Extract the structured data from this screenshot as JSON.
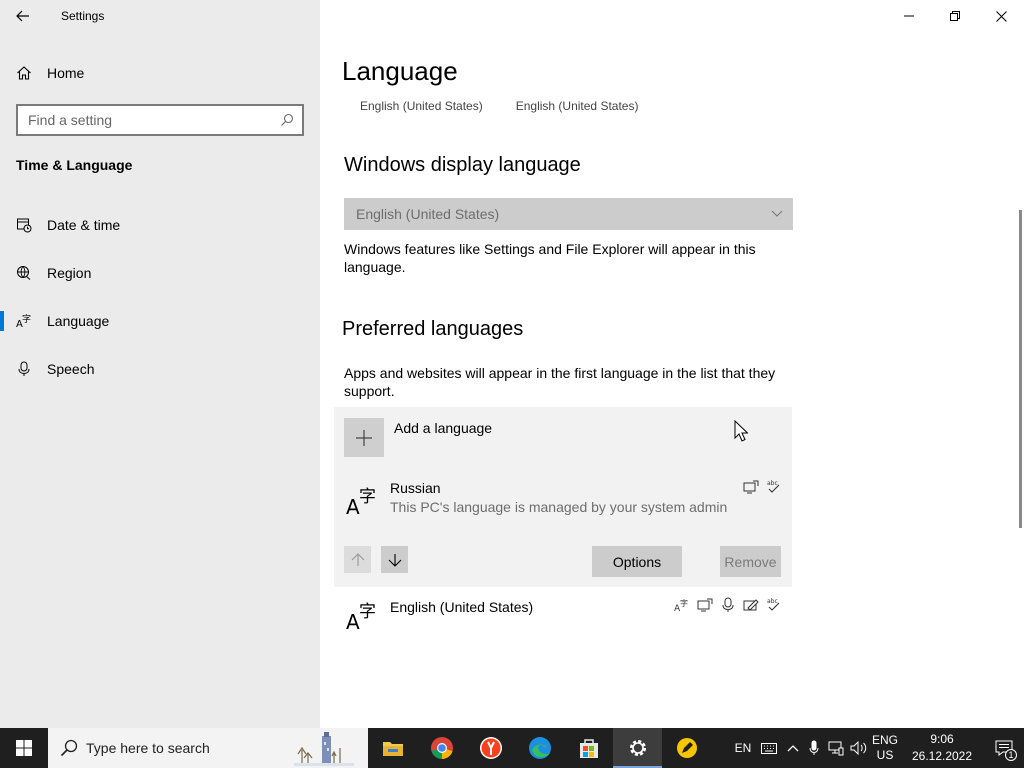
{
  "window": {
    "app_title": "Settings"
  },
  "sidebar": {
    "home_label": "Home",
    "search_placeholder": "Find a setting",
    "section_title": "Time & Language",
    "items": [
      {
        "label": "Date & time",
        "icon": "calendar-clock-icon"
      },
      {
        "label": "Region",
        "icon": "globe-icon"
      },
      {
        "label": "Language",
        "icon": "language-icon",
        "active": true
      },
      {
        "label": "Speech",
        "icon": "microphone-icon"
      }
    ]
  },
  "main": {
    "title": "Language",
    "header_links": [
      "English (United States)",
      "English (United States)"
    ],
    "display_language": {
      "heading": "Windows display language",
      "selected": "English (United States)",
      "description": "Windows features like Settings and File Explorer will appear in this language."
    },
    "preferred": {
      "heading": "Preferred languages",
      "description": "Apps and websites will appear in the first language in the list that they support.",
      "add_label": "Add a language",
      "languages": [
        {
          "name": "Russian",
          "subtitle": "This PC's language is managed by your system admin",
          "selected": true
        },
        {
          "name": "English (United States)",
          "subtitle": ""
        }
      ],
      "options_label": "Options",
      "remove_label": "Remove"
    }
  },
  "taskbar": {
    "search_placeholder": "Type here to search",
    "input_lang": "EN",
    "kb_lang_line1": "ENG",
    "kb_lang_line2": "US",
    "time": "9:06",
    "date": "26.12.2022",
    "notification_count": "1"
  },
  "colors": {
    "accent": "#0078d7",
    "sidebar_bg": "#ebebeb",
    "taskbar_bg": "#1f1f1f"
  }
}
